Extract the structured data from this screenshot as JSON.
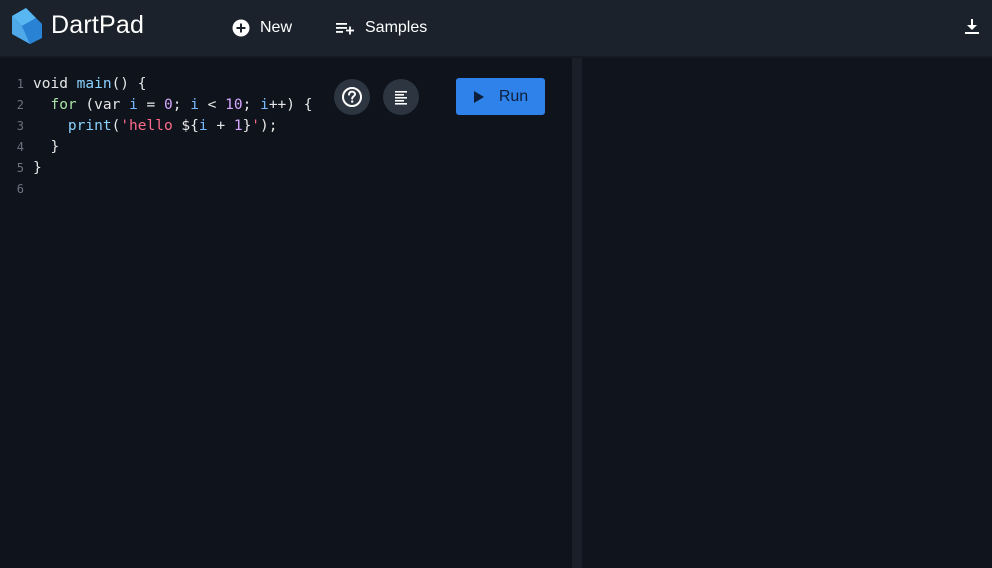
{
  "header": {
    "title": "DartPad",
    "new_label": "New",
    "samples_label": "Samples"
  },
  "editor": {
    "lines": [
      {
        "number": "1",
        "text": "void main() {"
      },
      {
        "number": "2",
        "text": "  for (var i = 0; i < 10; i++) {"
      },
      {
        "number": "3",
        "text": "    print('hello ${i + 1}');"
      },
      {
        "number": "4",
        "text": "  }"
      },
      {
        "number": "5",
        "text": "}"
      },
      {
        "number": "6",
        "text": ""
      }
    ],
    "run_label": "Run"
  },
  "icons": {
    "logo": "dart-logo",
    "new": "add-circle-icon",
    "samples": "playlist-add-icon",
    "download": "download-icon",
    "help": "help-icon",
    "format": "format-align-icon",
    "run": "play-icon"
  },
  "colors": {
    "run_button": "#2f82ea",
    "header_bg": "#1b222b",
    "editor_bg": "#0f141c"
  }
}
